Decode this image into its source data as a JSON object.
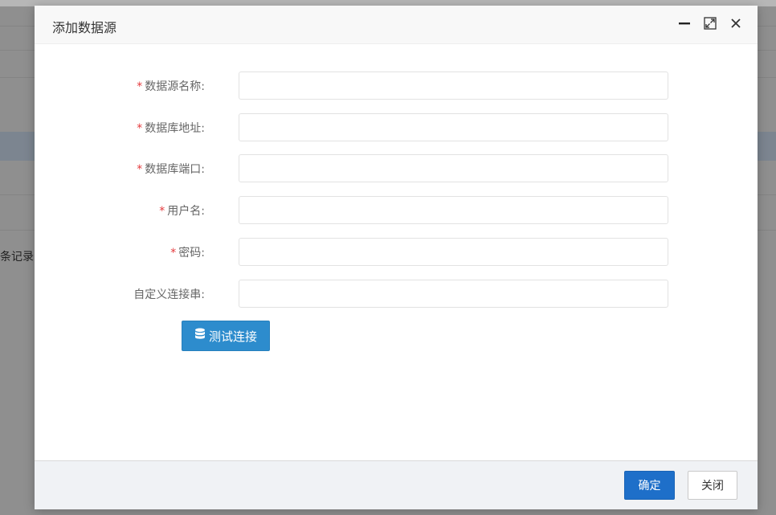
{
  "background": {
    "record_text": "条记录"
  },
  "dialog": {
    "title": "添加数据源",
    "icons": {
      "minimize": "minimize-icon",
      "maximize": "maximize-icon",
      "close": "close-icon"
    },
    "required_mark": "*",
    "fields": [
      {
        "label": "数据源名称:",
        "required": true,
        "value": "",
        "placeholder": ""
      },
      {
        "label": "数据库地址:",
        "required": true,
        "value": "",
        "placeholder": ""
      },
      {
        "label": "数据库端口:",
        "required": true,
        "value": "",
        "placeholder": ""
      },
      {
        "label": "用户名:",
        "required": true,
        "value": "",
        "placeholder": ""
      },
      {
        "label": "密码:",
        "required": true,
        "value": "",
        "placeholder": ""
      },
      {
        "label": "自定义连接串:",
        "required": false,
        "value": "",
        "placeholder": ""
      }
    ],
    "test_button": {
      "label": "测试连接",
      "icon": "database-icon"
    },
    "footer": {
      "ok_label": "确定",
      "close_label": "关闭"
    },
    "colors": {
      "primary": "#1e6fc9",
      "test_button": "#2d8ccd",
      "required": "#e4393c"
    }
  }
}
